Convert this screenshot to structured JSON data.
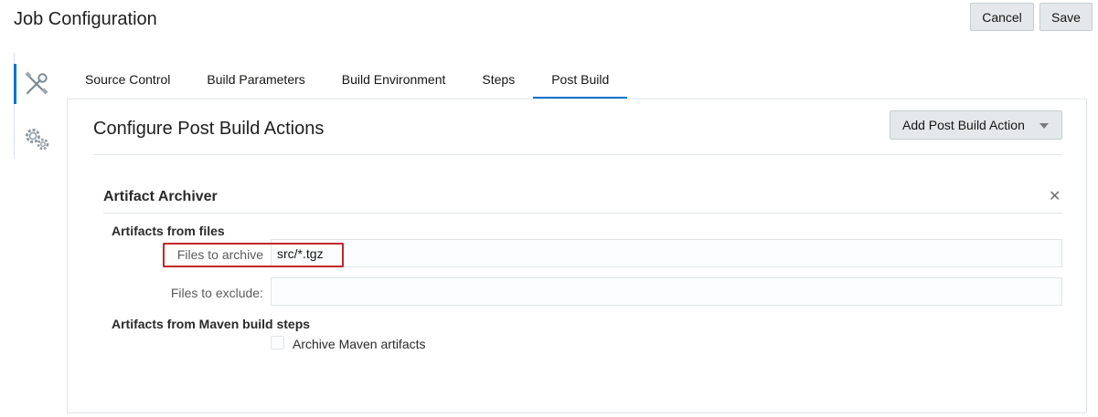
{
  "header": {
    "title": "Job Configuration",
    "cancel_label": "Cancel",
    "save_label": "Save"
  },
  "side_nav": {
    "items": [
      {
        "icon": "tools-icon",
        "active": true
      },
      {
        "icon": "gears-icon",
        "active": false
      }
    ]
  },
  "tabs": [
    {
      "label": "Source Control"
    },
    {
      "label": "Build Parameters"
    },
    {
      "label": "Build Environment"
    },
    {
      "label": "Steps"
    },
    {
      "label": "Post Build",
      "active": true
    }
  ],
  "panel": {
    "title": "Configure Post Build Actions",
    "add_action_label": "Add Post Build Action",
    "archiver": {
      "title": "Artifact Archiver",
      "close_glyph": "✕",
      "files_group_label": "Artifacts from files",
      "archive_label": "Files to archive",
      "archive_value": "src/*.tgz",
      "exclude_label": "Files to exclude:",
      "exclude_value": "",
      "maven_group_label": "Artifacts from Maven build steps",
      "maven_checkbox_label": "Archive Maven artifacts",
      "maven_checked": false
    }
  },
  "colors": {
    "accent": "#0572ce",
    "highlight": "#c2272d",
    "button_bg": "#e4e8ea"
  }
}
